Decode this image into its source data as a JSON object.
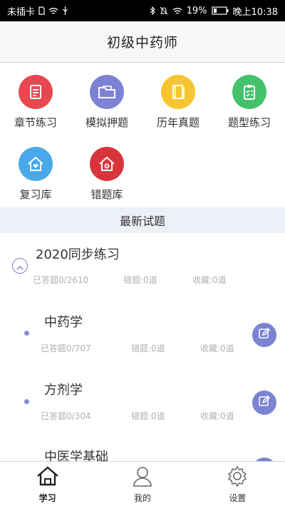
{
  "status_bar": {
    "carrier": "未插卡",
    "battery": "19%",
    "time": "晚上10:38"
  },
  "header": {
    "title": "初级中药师"
  },
  "grid": {
    "items": [
      {
        "label": "章节练习",
        "icon": "document-icon",
        "color": "#e8474f"
      },
      {
        "label": "模拟押题",
        "icon": "folder-icon",
        "color": "#7c83d4"
      },
      {
        "label": "历年真题",
        "icon": "book-icon",
        "color": "#f7c52f"
      },
      {
        "label": "题型练习",
        "icon": "clipboard-icon",
        "color": "#43c26b"
      },
      {
        "label": "复习库",
        "icon": "house-heart-icon",
        "color": "#48a8ea"
      },
      {
        "label": "错题库",
        "icon": "house-x-icon",
        "color": "#d9343c"
      }
    ]
  },
  "section": {
    "title": "最新试题"
  },
  "list": {
    "group": {
      "title": "2020同步练习",
      "answered": "已答题0/2610",
      "wrong": "错题:0道",
      "favorites": "收藏:0道"
    },
    "items": [
      {
        "title": "中药学",
        "answered": "已答题0/707",
        "wrong": "错题:0道",
        "favorites": "收藏:0道"
      },
      {
        "title": "方剂学",
        "answered": "已答题0/304",
        "wrong": "错题:0道",
        "favorites": "收藏:0道"
      },
      {
        "title": "中医学基础"
      }
    ]
  },
  "bottom_nav": {
    "items": [
      {
        "label": "学习",
        "icon": "home-icon",
        "active": true
      },
      {
        "label": "我的",
        "icon": "user-icon",
        "active": false
      },
      {
        "label": "设置",
        "icon": "gear-icon",
        "active": false
      }
    ]
  },
  "colors": {
    "accent": "#7b83d3",
    "section_bg": "#eef0f8",
    "stat_text": "#b0b0b0"
  }
}
